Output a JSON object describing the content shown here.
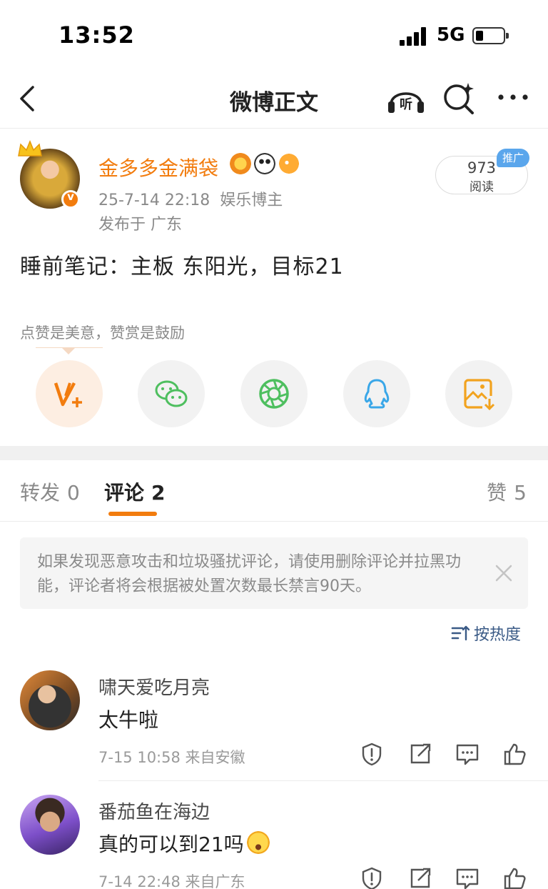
{
  "status_bar": {
    "time": "13:52",
    "network": "5G"
  },
  "nav": {
    "title": "微博正文",
    "listen_label": "听"
  },
  "post": {
    "author": "金多多金满袋",
    "date": "25-7-14 22:18",
    "author_tag": "娱乐博主",
    "location": "发布于 广东",
    "read_count": "973",
    "read_label": "阅读",
    "promo_label": "推广",
    "content": "睡前笔记：主板  东阳光，目标21",
    "reward_tip": "点赞是美意，赞赏是鼓励"
  },
  "share_icons": [
    "reward-v-plus-icon",
    "wechat-icon",
    "moments-icon",
    "qq-icon",
    "save-image-icon"
  ],
  "colors": {
    "accent": "#f27c0e",
    "link_blue": "#3a5a86",
    "wechat_green": "#4ebf5f",
    "qq_blue": "#3aa7e8"
  },
  "tabs": {
    "repost": {
      "label": "转发",
      "count": "0"
    },
    "comments": {
      "label": "评论",
      "count": "2"
    },
    "likes": {
      "label": "赞",
      "count": "5"
    }
  },
  "notice": {
    "text": "如果发现恶意攻击和垃圾骚扰评论，请使用删除评论并拉黑功能，评论者将会根据被处置次数最长禁言90天。"
  },
  "sort": {
    "label": "按热度"
  },
  "comments": [
    {
      "name": "啸天爱吃月亮",
      "text": "太牛啦",
      "meta": "7-15 10:58 来自安徽"
    },
    {
      "name": "番茄鱼在海边",
      "text": "真的可以到21吗",
      "meta": "7-14 22:48 来自广东"
    }
  ]
}
